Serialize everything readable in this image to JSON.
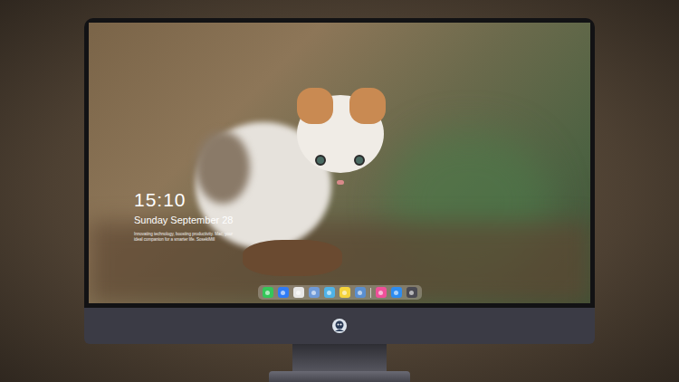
{
  "lock_screen": {
    "time": "15:10",
    "date": "Sunday September 28",
    "tagline": "Innovating technology, boosting productivity. Mac, your ideal companion for a smarter life. SosekiMill"
  },
  "dock": {
    "items": [
      {
        "kind": "app",
        "color": "#34c759"
      },
      {
        "kind": "app",
        "color": "#2f7bf5"
      },
      {
        "kind": "app",
        "color": "#e8e8e8"
      },
      {
        "kind": "app",
        "color": "#6f9ad8"
      },
      {
        "kind": "app",
        "color": "#4fb3e8"
      },
      {
        "kind": "app",
        "color": "#f5d33c"
      },
      {
        "kind": "app",
        "color": "#5a8fd0"
      },
      {
        "kind": "separator"
      },
      {
        "kind": "app",
        "color": "#f0509a"
      },
      {
        "kind": "app",
        "color": "#2d8cf0"
      },
      {
        "kind": "app",
        "color": "#4a4a52"
      }
    ]
  }
}
